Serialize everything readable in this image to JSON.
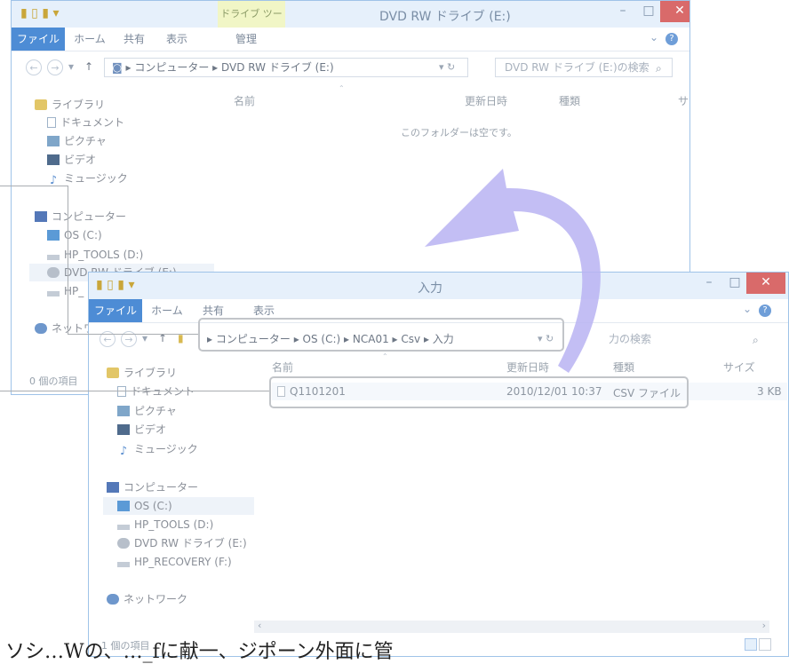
{
  "colors": {
    "file_tab": "#4d8cd5",
    "titlebar": "#e6f0fb",
    "close_button": "#d96a6a",
    "context_tab": "#f1f6c6",
    "arrow": "#b8b3f2",
    "highlight_border": "#c2c5c9"
  },
  "win_back": {
    "title": "DVD RW ドライブ (E:)",
    "context_tab": "ドライブ ツール",
    "tabs": {
      "file": "ファイル",
      "home": "ホーム",
      "share": "共有",
      "view": "表示",
      "manage": "管理"
    },
    "address": {
      "computer": "コンピューター",
      "drive": "DVD RW ドライブ (E:)"
    },
    "search_placeholder": "DVD RW ドライブ (E:)の検索",
    "nav": {
      "library": "ライブラリ",
      "documents": "ドキュメント",
      "pictures": "ピクチャ",
      "videos": "ビデオ",
      "music": "ミュージック",
      "computer": "コンピューター",
      "os_c": "OS (C:)",
      "hp_tools": "HP_TOOLS (D:)",
      "dvd": "DVD RW ドライブ (E:)",
      "hp_partial": "HP_",
      "network_partial": "ネットワ"
    },
    "columns": {
      "name": "名前",
      "date": "更新日時",
      "type": "種類",
      "size_partial": "サ"
    },
    "empty_message": "このフォルダーは空です。",
    "status": "0 個の項目"
  },
  "win_front": {
    "title": "入力",
    "tabs": {
      "file": "ファイル",
      "home": "ホーム",
      "share": "共有",
      "view": "表示"
    },
    "address": {
      "computer": "コンピューター",
      "os": "OS (C:)",
      "folder1": "NCA01",
      "folder2": "Csv",
      "folder3": "入力"
    },
    "search_placeholder": "力の検索",
    "nav": {
      "library": "ライブラリ",
      "documents": "ドキュメント",
      "pictures": "ピクチャ",
      "videos": "ビデオ",
      "music": "ミュージック",
      "computer": "コンピューター",
      "os_c": "OS (C:)",
      "hp_tools": "HP_TOOLS (D:)",
      "dvd": "DVD RW ドライブ (E:)",
      "hp_recovery": "HP_RECOVERY (F:)",
      "network": "ネットワーク"
    },
    "columns": {
      "name": "名前",
      "date": "更新日時",
      "type": "種類",
      "size": "サイズ"
    },
    "files": [
      {
        "name": "Q1101201",
        "date": "2010/12/01 10:37",
        "type": "CSV ファイル",
        "size": "3 KB"
      }
    ],
    "status": "1 個の項目"
  },
  "caption": "ソシ…Wの、…_fに献一、ジポーン外面に管"
}
